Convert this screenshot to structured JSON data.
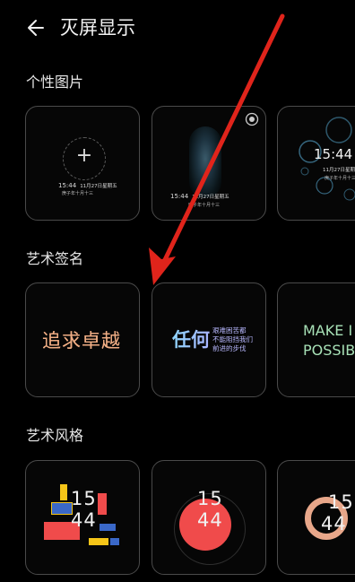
{
  "header": {
    "title": "灭屏显示"
  },
  "sections": [
    {
      "title": "个性图片"
    },
    {
      "title": "艺术签名"
    },
    {
      "title": "艺术风格"
    }
  ],
  "personal": {
    "time": "15:44",
    "date": "11月27日星期五",
    "lunar": "庚子年十月十三"
  },
  "signature": {
    "text1": "追求卓越",
    "text2_big": "任何",
    "text2_lines": [
      "艰难困苦都",
      "不能阻挡我们",
      "前进的步伐"
    ],
    "text3_lines": [
      "MAKE I",
      "POSSIB"
    ]
  },
  "style": {
    "hour": "15",
    "minute": "44"
  },
  "colors": {
    "background": "#000000",
    "card_border": "#4a4a4a",
    "arrow": "#e0241b",
    "style_red": "#f04b4b",
    "style_blue": "#3a68c8",
    "style_yellow": "#f5c518"
  }
}
